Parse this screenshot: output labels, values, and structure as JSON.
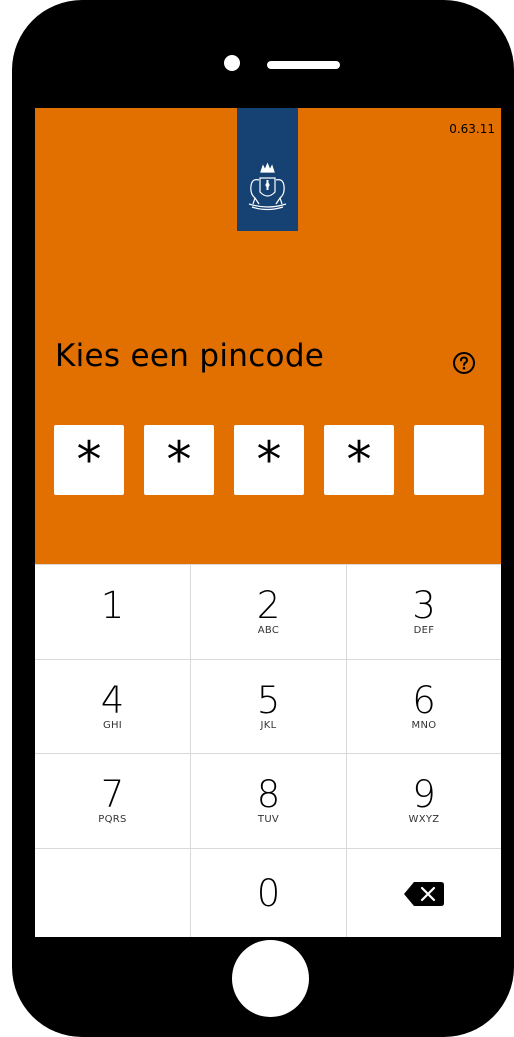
{
  "app": {
    "version": "0.63.11",
    "header_color": "#E17000",
    "banner_color": "#154273"
  },
  "pin": {
    "title": "Kies een pincode",
    "help_icon": "question-circle-icon",
    "digits": [
      "*",
      "*",
      "*",
      "*",
      ""
    ]
  },
  "keypad": {
    "keys": [
      {
        "num": "1",
        "letters": ""
      },
      {
        "num": "2",
        "letters": "ABC"
      },
      {
        "num": "3",
        "letters": "DEF"
      },
      {
        "num": "4",
        "letters": "GHI"
      },
      {
        "num": "5",
        "letters": "JKL"
      },
      {
        "num": "6",
        "letters": "MNO"
      },
      {
        "num": "7",
        "letters": "PQRS"
      },
      {
        "num": "8",
        "letters": "TUV"
      },
      {
        "num": "9",
        "letters": "WXYZ"
      },
      {
        "num": "0",
        "letters": ""
      }
    ],
    "backspace_icon": "backspace-icon"
  }
}
